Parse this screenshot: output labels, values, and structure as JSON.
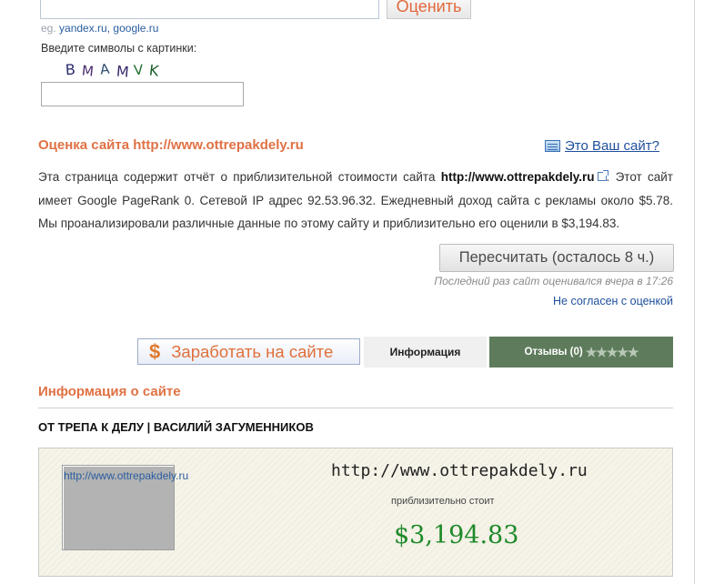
{
  "form": {
    "evaluate_label": "Оценить",
    "examples_prefix": "eg.",
    "example_1": "yandex.ru,",
    "example_2": "google.ru",
    "captcha_label": "Введите символы с картинки:",
    "captcha_text": "BMAMVK"
  },
  "estimate": {
    "title": "Оценка сайта http://www.ottrepakdely.ru",
    "your_site_link": "Это Ваш сайт?",
    "desc_part1": "Эта страница содержит отчёт о приблизительной стоимости сайта ",
    "desc_site": "http://www.ottrepakdely.ru",
    "desc_part2": ". Этот сайт имеет Google PageRank 0. Сетевой IP адрес 92.53.96.32. Ежедневный доход сайта с рекламы около $5.78. Мы проанализировали различные данные по этому сайту и приблизительно его оценили в $3,194.83.",
    "recalc_button": "Пересчитать (осталось 8 ч.)",
    "last_evaluated": "Последний раз сайт оценивался вчера в 17:26",
    "disagree_link": "Не согласен с оценкой"
  },
  "tabs": {
    "earn_icon": "$",
    "earn_label": "Заработать на сайте",
    "info_label": "Информация",
    "reviews_label": "Отзывы (0)",
    "reviews_stars": "★★★★★",
    "rating": 0
  },
  "info": {
    "title": "Информация о сайте",
    "site_name": "ОТ ТРЕПА К ДЕЛУ | ВАСИЛИЙ ЗАГУМЕННИКОВ",
    "thumbnail_alt": "http://www.ottrepakdely.ru",
    "card_url": "http://www.ottrepakdely.ru",
    "card_costs_label": "приблизительно стоит",
    "card_price": "$3,194.83"
  },
  "colors": {
    "accent_orange": "#e07144",
    "link_blue": "#1f4f9c",
    "price_green": "#1e8a2a",
    "reviews_tab": "#5e7c5c"
  }
}
